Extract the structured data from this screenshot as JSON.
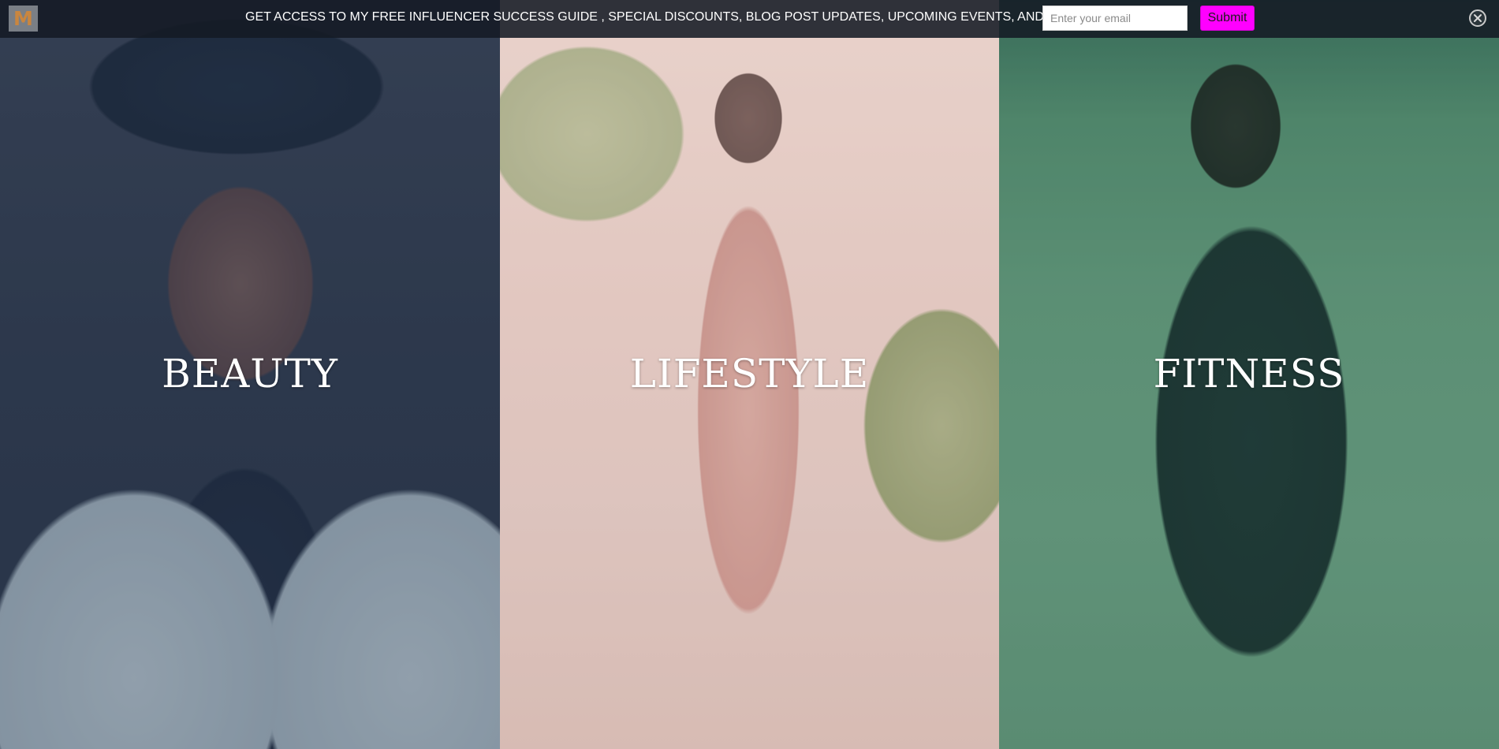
{
  "banner": {
    "logo_letter": "M",
    "message": "GET ACCESS TO MY FREE INFLUENCER SUCCESS GUIDE , SPECIAL DISCOUNTS, BLOG POST UPDATES, UPCOMING EVENTS, AND MORE!",
    "email_placeholder": "Enter your email",
    "submit_label": "Submit",
    "close_icon": "close-circle-icon",
    "colors": {
      "bar_background": "#141a24",
      "submit_background": "#ff00ff",
      "logo_letter": "#c9863f"
    }
  },
  "panels": [
    {
      "label": "BEAUTY",
      "overlay_color": "#283c5a"
    },
    {
      "label": "LIFESTYLE",
      "overlay_color": "#f0c8c8"
    },
    {
      "label": "FITNESS",
      "overlay_color": "#286e5a"
    }
  ]
}
